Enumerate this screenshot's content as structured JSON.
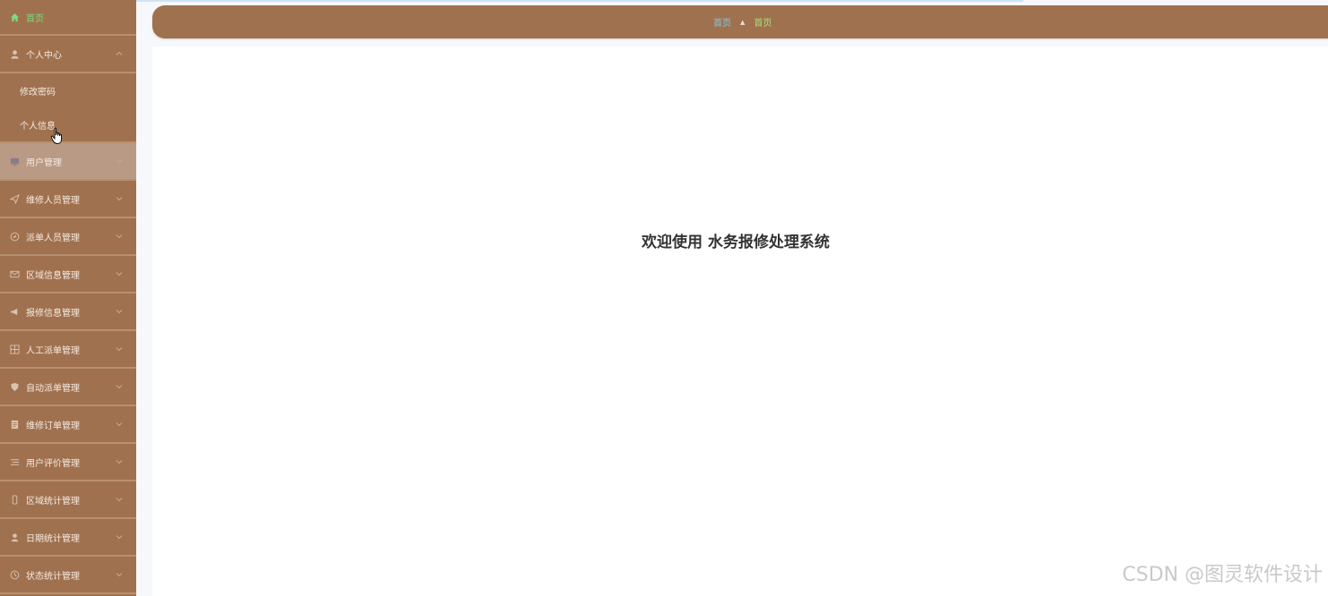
{
  "sidebar": {
    "home": {
      "label": "首页",
      "icon": "home-icon"
    },
    "personal": {
      "label": "个人中心",
      "icon": "user-icon",
      "children": [
        {
          "label": "修改密码"
        },
        {
          "label": "个人信息"
        }
      ]
    },
    "items": [
      {
        "label": "用户管理",
        "icon": "monitor-icon"
      },
      {
        "label": "维修人员管理",
        "icon": "send-icon"
      },
      {
        "label": "派单人员管理",
        "icon": "compass-icon"
      },
      {
        "label": "区域信息管理",
        "icon": "mail-icon"
      },
      {
        "label": "报修信息管理",
        "icon": "megaphone-icon"
      },
      {
        "label": "人工派单管理",
        "icon": "grid-icon"
      },
      {
        "label": "自动派单管理",
        "icon": "shield-icon"
      },
      {
        "label": "维修订单管理",
        "icon": "document-icon"
      },
      {
        "label": "用户评价管理",
        "icon": "list-icon"
      },
      {
        "label": "区域统计管理",
        "icon": "phone-icon"
      },
      {
        "label": "日期统计管理",
        "icon": "person-icon"
      },
      {
        "label": "状态统计管理",
        "icon": "clock-icon"
      }
    ]
  },
  "breadcrumb": {
    "first": "首页",
    "second": "首页"
  },
  "main": {
    "welcome": "欢迎使用 水务报修处理系统"
  },
  "watermark": "CSDN @图灵软件设计",
  "colors": {
    "sidebar_bg": "#a0714f",
    "header_bg": "#a0714f",
    "active_item": "#b99a84",
    "home_green": "#7ed97e"
  }
}
